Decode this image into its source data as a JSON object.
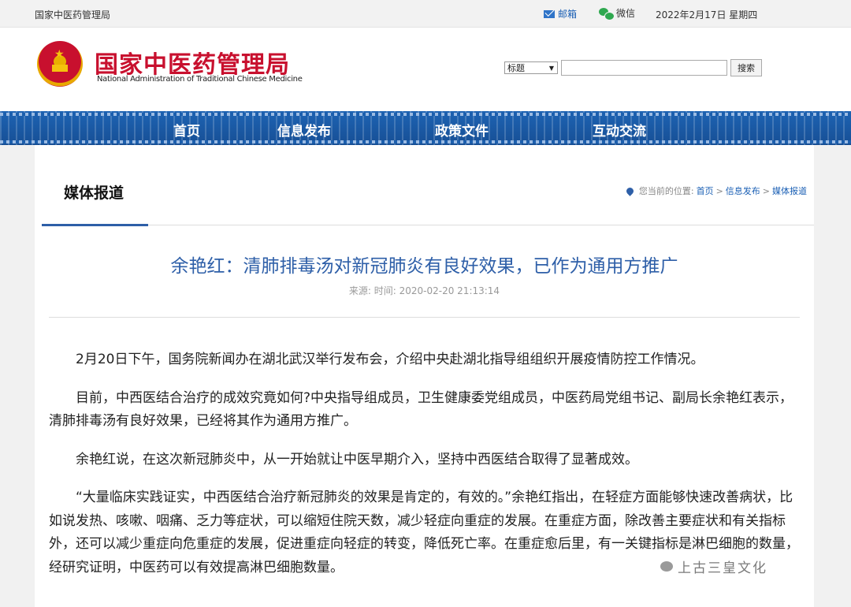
{
  "topbar": {
    "site_name": "国家中医药管理局",
    "mail_label": "邮箱",
    "wechat_label": "微信",
    "date": "2022年2月17日 星期四"
  },
  "header": {
    "logo_cn": "国家中医药管理局",
    "logo_en": "National Administration of Traditional Chinese Medicine",
    "search_select_value": "标题",
    "search_input_value": "",
    "search_button": "搜索"
  },
  "nav": {
    "items": [
      {
        "label": "首页"
      },
      {
        "label": "信息发布"
      },
      {
        "label": "政策文件"
      },
      {
        "label": "互动交流"
      }
    ]
  },
  "section": {
    "title": "媒体报道",
    "location_label": "您当前的位置:",
    "crumbs": [
      "首页",
      "信息发布",
      "媒体报道"
    ],
    "separator": ">"
  },
  "article": {
    "title": "余艳红：清肺排毒汤对新冠肺炎有良好效果，已作为通用方推广",
    "meta": "来源:  时间:  2020-02-20 21:13:14",
    "paragraphs": [
      "2月20日下午，国务院新闻办在湖北武汉举行发布会，介绍中央赴湖北指导组组织开展疫情防控工作情况。",
      "目前，中西医结合治疗的成效究竟如何?中央指导组成员，卫生健康委党组成员，中医药局党组书记、副局长余艳红表示，清肺排毒汤有良好效果，已经将其作为通用方推广。",
      "余艳红说，在这次新冠肺炎中，从一开始就让中医早期介入，坚持中西医结合取得了显著成效。",
      "“大量临床实践证实，中西医结合治疗新冠肺炎的效果是肯定的，有效的。”余艳红指出，在轻症方面能够快速改善病状，比如说发热、咳嗽、咽痛、乏力等症状，可以缩短住院天数，减少轻症向重症的发展。在重症方面，除改善主要症状和有关指标外，还可以减少重症向危重症的发展，促进重症向轻症的转变，降低死亡率。在重症愈后里，有一关键指标是淋巴细胞的数量，经研究证明，中医药可以有效提高淋巴细胞数量。"
    ]
  },
  "watermark": "上古三皇文化"
}
